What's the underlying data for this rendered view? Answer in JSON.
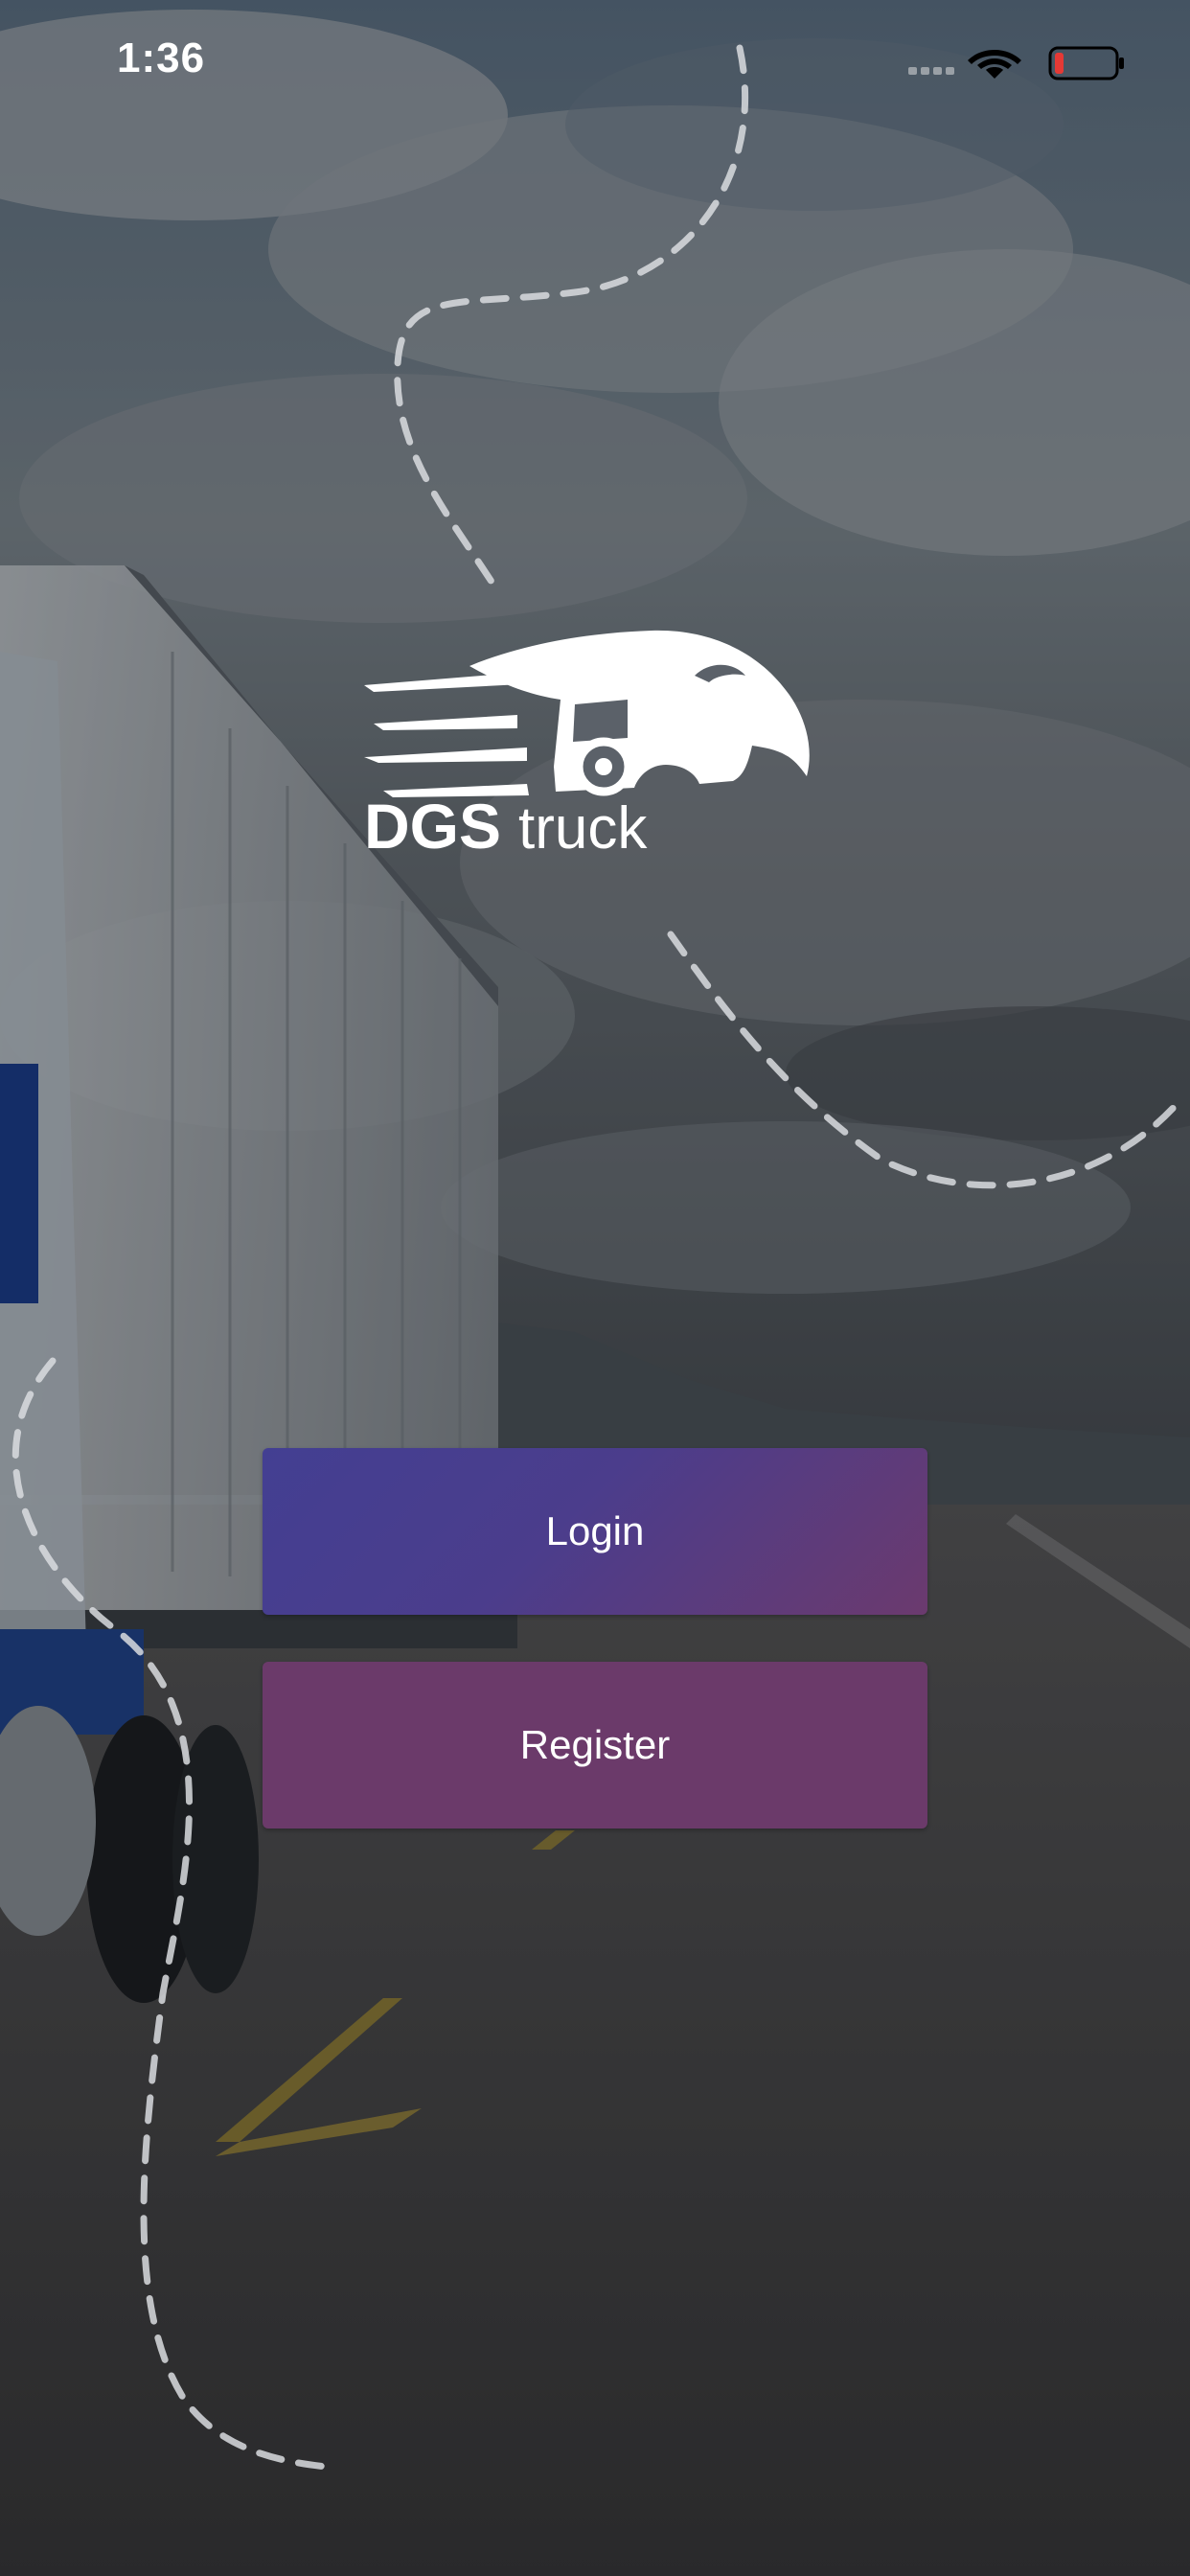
{
  "status_bar": {
    "time": "1:36",
    "icons": [
      "cellular-signal-icon",
      "wifi-icon",
      "battery-low-icon"
    ],
    "battery_color": "#e53935"
  },
  "brand": {
    "name_bold": "DGS",
    "name_light": "truck"
  },
  "actions": {
    "login_label": "Login",
    "register_label": "Register"
  },
  "colors": {
    "login_start": "#433f92",
    "login_end": "#6b3a6e",
    "register": "#6b3a6a"
  }
}
